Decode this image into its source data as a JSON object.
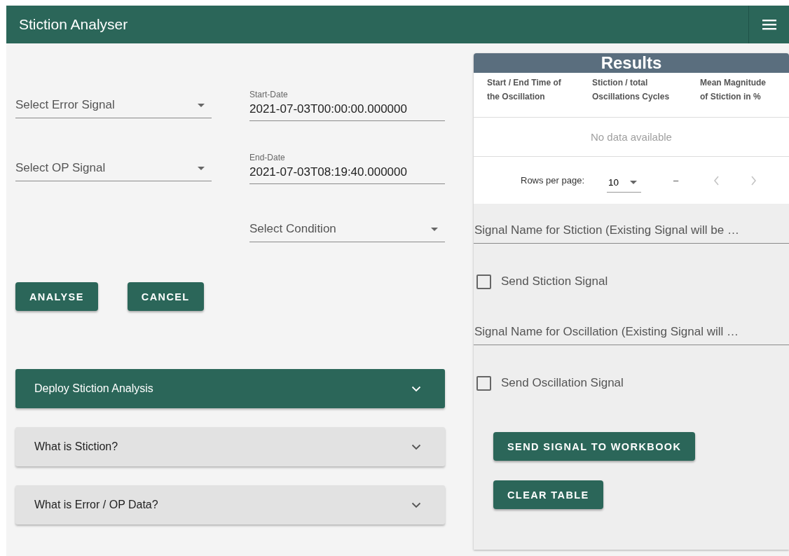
{
  "app_bar": {
    "title": "Stiction Analyser"
  },
  "signals": [
    {
      "placeholder": "Select Error Signal"
    },
    {
      "placeholder": "Select OP Signal"
    }
  ],
  "dates": [
    {
      "label": "Start-Date",
      "value": "2021-07-03T00:00:00.000000"
    },
    {
      "label": "End-Date",
      "value": "2021-07-03T08:19:40.000000"
    }
  ],
  "condition": {
    "placeholder": "Select Condition"
  },
  "actions": [
    "ANALYSE",
    "CANCEL"
  ],
  "panels": [
    {
      "kind": "primary",
      "title": "Deploy Stiction Analysis",
      "expanded": false
    },
    {
      "kind": "plain",
      "title": "What is Stiction?",
      "expanded": false
    },
    {
      "kind": "plain",
      "title": "What is Error / OP Data?",
      "expanded": false
    }
  ],
  "results": {
    "title": "Results",
    "columns": [
      "Start / End Time of the Oscillation",
      "Stiction / total Oscillations Cycles",
      "Mean Magnitude of Stiction in %"
    ],
    "empty_text": "No data available",
    "rows_per_page_label": "Rows per page:",
    "rows_per_page": "10",
    "range": "–"
  },
  "outputs": [
    {
      "kind": "field",
      "placeholder": "Signal Name for Stiction (Existing Signal will be …"
    },
    {
      "kind": "checkbox",
      "label": "Send Stiction Signal",
      "checked": false
    },
    {
      "kind": "field",
      "placeholder": "Signal Name for Oscillation (Existing Signal will …"
    },
    {
      "kind": "checkbox",
      "label": "Send Oscillation Signal",
      "checked": false
    }
  ],
  "output_buttons": [
    "SEND SIGNAL TO WORKBOOK",
    "CLEAR TABLE"
  ]
}
